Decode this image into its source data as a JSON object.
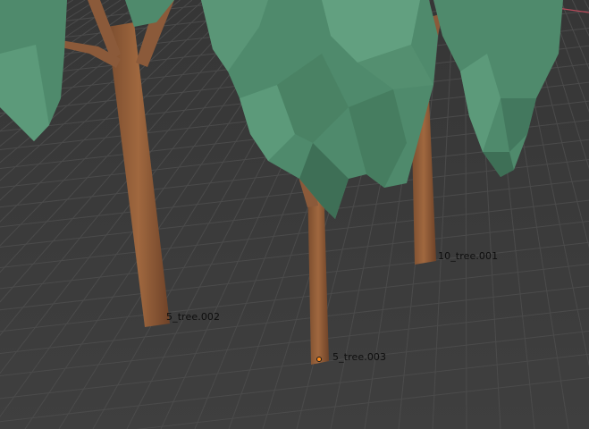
{
  "viewport": {
    "background": "#3d3d3d",
    "grid_color": "#4b4b4b",
    "axis_color": "#b84a5a",
    "trunk_color": "#8b5a3a",
    "foliage_color": "#4f8a6c",
    "selected_origin_color": "#ff8c1a"
  },
  "objects": [
    {
      "name": "5_tree.002",
      "selected": false
    },
    {
      "name": "5_tree.003",
      "selected": true
    },
    {
      "name": "10_tree.001",
      "selected": false
    }
  ]
}
